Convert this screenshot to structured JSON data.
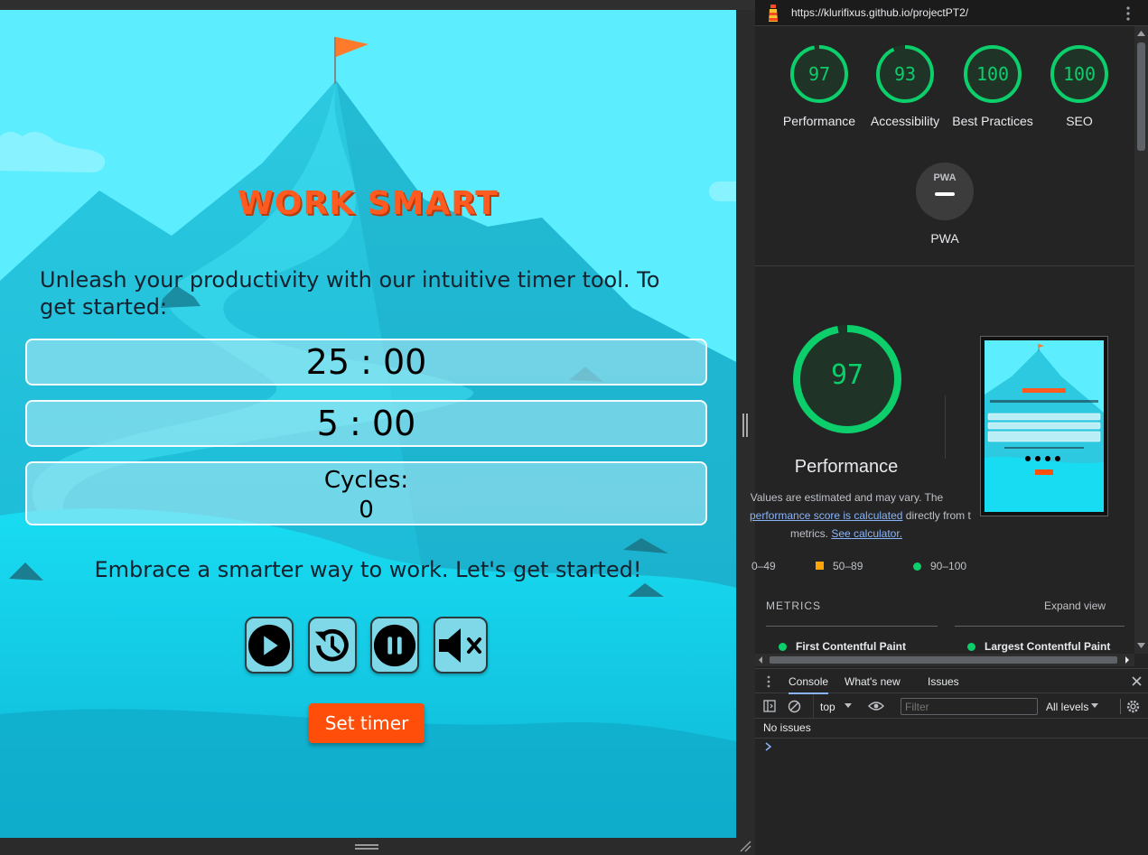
{
  "page": {
    "title": "WORK SMART",
    "intro": "Unleash your productivity with our intuitive timer tool. To get started:",
    "work_timer": "25 : 00",
    "break_timer": "5 : 00",
    "cycles_label": "Cycles:",
    "cycles_value": "0",
    "tagline": "Embrace a smarter way to work. Let's get started!",
    "set_timer_label": "Set timer",
    "controls": [
      "play-icon",
      "reset-history-icon",
      "pause-icon",
      "mute-icon"
    ],
    "colors": {
      "accent": "#ff4d0a",
      "sky": "#5ceeff",
      "title": "#ff5a1f"
    }
  },
  "devtools": {
    "url": "https://klurifixus.github.io/projectPT2/",
    "scores": [
      {
        "value": "97",
        "label": "Performance"
      },
      {
        "value": "93",
        "label": "Accessibility"
      },
      {
        "value": "100",
        "label": "Best Practices"
      },
      {
        "value": "100",
        "label": "SEO"
      }
    ],
    "pwa": {
      "badge": "PWA",
      "label": "PWA"
    },
    "performance": {
      "score": "97",
      "label": "Performance",
      "note_1": "Values are estimated and may vary. The",
      "note_link": "performance score is calculated",
      "note_2": "directly from these",
      "note_3": "metrics.",
      "note_link_2": "See calculator."
    },
    "legend": {
      "fail": "0–49",
      "average": "50–89",
      "pass": "90–100"
    },
    "metrics_heading": "METRICS",
    "expand_view": "Expand view",
    "metrics": [
      "First Contentful Paint",
      "Largest Contentful Paint"
    ],
    "drawer": {
      "tabs": [
        "Console",
        "What's new",
        "Issues"
      ],
      "context": "top",
      "filter_placeholder": "Filter",
      "levels": "All levels",
      "no_issues": "No issues"
    },
    "colors": {
      "pass": "#0cce6b",
      "average": "#ffa400",
      "link": "#8ab4f8"
    }
  }
}
